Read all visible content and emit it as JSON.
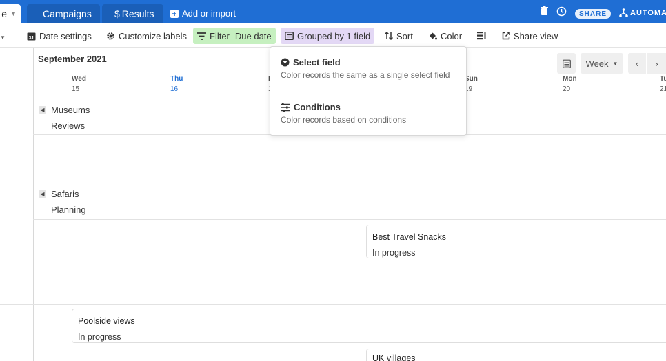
{
  "tabs": {
    "active_fragment": "e",
    "campaigns": "Campaigns",
    "results": "Results",
    "add_import": "Add or import"
  },
  "header": {
    "share": "SHARE",
    "automations": "AUTOMAT"
  },
  "toolbar": {
    "date_settings": "Date settings",
    "customize_labels": "Customize labels",
    "filter": "Filter",
    "filter_value": "Due date",
    "grouped": "Grouped by 1 field",
    "sort": "Sort",
    "color": "Color",
    "share_view": "Share view"
  },
  "calendar": {
    "month": "September 2021",
    "view": "Week",
    "days": [
      {
        "name": "Wed",
        "num": "15"
      },
      {
        "name": "Thu",
        "num": "16"
      },
      {
        "name": "F",
        "num": "1"
      },
      {
        "name": "Sun",
        "num": "19"
      },
      {
        "name": "Mon",
        "num": "20"
      },
      {
        "name": "Tu",
        "num": "21"
      }
    ]
  },
  "groups": [
    {
      "name": "Museums",
      "sub": "Reviews"
    },
    {
      "name": "Safaris",
      "sub": "Planning"
    }
  ],
  "cards": [
    {
      "title": "Best Travel Snacks",
      "status": "In progress"
    },
    {
      "title": "Poolside views",
      "status": "In progress"
    },
    {
      "title": "UK villages",
      "status": ""
    }
  ],
  "color_menu": {
    "select_field": {
      "title": "Select field",
      "desc": "Color records the same as a single select field"
    },
    "conditions": {
      "title": "Conditions",
      "desc": "Color records based on conditions"
    }
  },
  "colors": {
    "brand": "#1f6ed4",
    "filter_bg": "#c6f0c0",
    "group_bg": "#e3d8f5",
    "today": "#3a7bd5"
  }
}
